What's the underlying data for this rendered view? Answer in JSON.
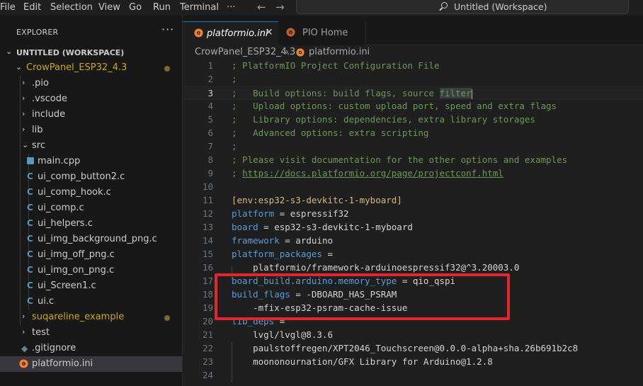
{
  "menu": [
    "File",
    "Edit",
    "Selection",
    "View",
    "Go",
    "Run",
    "Terminal",
    "···"
  ],
  "search": {
    "text": "Untitled (Workspace)"
  },
  "explorer": {
    "title": "EXPLORER",
    "more": "···",
    "workspace": "UNTITLED (WORKSPACE)",
    "project": "CrowPanel_ESP32_4.3",
    "items": [
      {
        "label": ".pio"
      },
      {
        "label": ".vscode"
      },
      {
        "label": "include"
      },
      {
        "label": "lib"
      },
      {
        "label": "src"
      },
      {
        "label": "main.cpp"
      },
      {
        "label": "ui_comp_button2.c"
      },
      {
        "label": "ui_comp_hook.c"
      },
      {
        "label": "ui_comp.c"
      },
      {
        "label": "ui_helpers.c"
      },
      {
        "label": "ui_img_background_png.c"
      },
      {
        "label": "ui_img_off_png.c"
      },
      {
        "label": "ui_img_on_png.c"
      },
      {
        "label": "ui_Screen1.c"
      },
      {
        "label": "ui.c"
      },
      {
        "label": "suqareline_example"
      },
      {
        "label": "test"
      },
      {
        "label": ".gitignore"
      },
      {
        "label": "platformio.ini"
      }
    ],
    "c_glyph": "C"
  },
  "tabs": [
    {
      "label": "platformio.ini",
      "close": "✕"
    },
    {
      "label": "PIO Home"
    }
  ],
  "breadcrumb": {
    "folder": "CrowPanel_ESP32_4.3",
    "sep": "›",
    "file": "platformio.ini"
  },
  "lines": [
    {
      "n": "1",
      "t": "; PlatformIO Project Configuration File"
    },
    {
      "n": "2",
      "t": ";"
    },
    {
      "n": "3",
      "a": ";   Build options: build flags, source ",
      "b": "filter"
    },
    {
      "n": "4",
      "t": ";   Upload options: custom upload port, speed and extra flags"
    },
    {
      "n": "5",
      "t": ";   Library options: dependencies, extra library storages"
    },
    {
      "n": "6",
      "t": ";   Advanced options: extra scripting"
    },
    {
      "n": "7",
      "t": ";"
    },
    {
      "n": "8",
      "t": "; Please visit documentation for the other options and examples"
    },
    {
      "n": "9",
      "a": "; ",
      "b": "https://docs.platformio.org/page/projectconf.html"
    },
    {
      "n": "10",
      "t": ""
    },
    {
      "n": "11",
      "t": "[env:esp32-s3-devkitc-1-myboard]"
    },
    {
      "n": "12",
      "k": "platform",
      "v": " = espressif32"
    },
    {
      "n": "13",
      "k": "board",
      "v": " = esp32-s3-devkitc-1-myboard"
    },
    {
      "n": "14",
      "k": "framework",
      "v": " = arduino"
    },
    {
      "n": "15",
      "k": "platform_packages",
      "v": " ="
    },
    {
      "n": "16",
      "t": "    platformio/framework-arduinoespressif32@^3.20003.0"
    },
    {
      "n": "17",
      "k": "board_build.arduino.memory_type",
      "v": " = qio_qspi"
    },
    {
      "n": "18",
      "k": "build_flags",
      "v": " = -DBOARD_HAS_PSRAM"
    },
    {
      "n": "19",
      "t": "    -mfix-esp32-psram-cache-issue"
    },
    {
      "n": "20",
      "k": "lib_deps",
      "v": " ="
    },
    {
      "n": "21",
      "t": "    lvgl/lvgl@8.3.6"
    },
    {
      "n": "22",
      "t": "    paulstoffregen/XPT2046_Touchscreen@0.0.0-alpha+sha.26b691b2c8"
    },
    {
      "n": "23",
      "t": "    moononournation/GFX Library for Arduino@1.2.8"
    },
    {
      "n": "24",
      "t": ""
    }
  ],
  "colors": {
    "comment": "#6a9955",
    "key": "#569cd6",
    "section": "#d7ba7d",
    "highlight_box": "#e3262c",
    "modified": "#cca700",
    "accent": "#0078d4"
  }
}
